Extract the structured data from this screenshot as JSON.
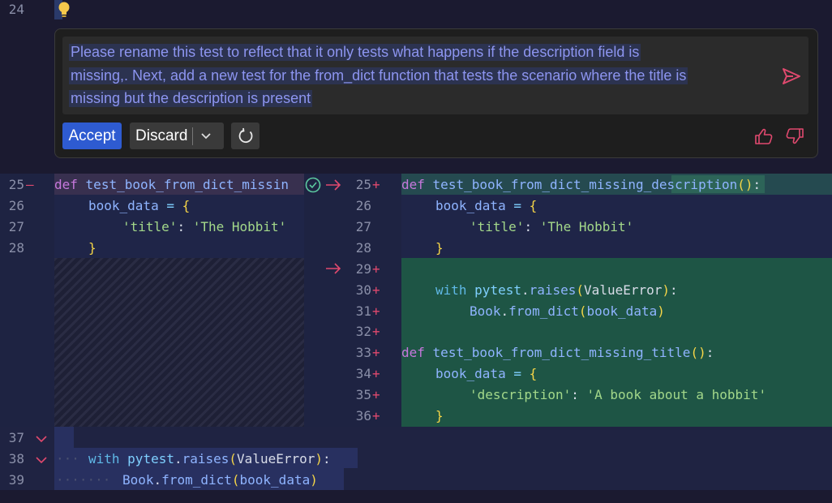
{
  "editor": {
    "line_24": "24",
    "lightbulb": "lightbulb-icon"
  },
  "prompt": {
    "line1": "Please rename this test to reflect that it only tests what happens if the description field is",
    "line2": "missing,. Next, add a new test for the from_dict function that tests the scenario where the title is",
    "line3": "missing but the description is present",
    "send_icon": "send-icon"
  },
  "actions": {
    "accept_label": "Accept",
    "discard_label": "Discard",
    "chevron_icon": "chevron-down-icon",
    "regenerate_icon": "refresh-icon",
    "thumbs_up_icon": "thumbs-up-icon",
    "thumbs_down_icon": "thumbs-down-icon"
  },
  "left": {
    "lines": [
      {
        "num": "25",
        "marker": "—"
      },
      {
        "num": "26",
        "marker": ""
      },
      {
        "num": "27",
        "marker": ""
      },
      {
        "num": "28",
        "marker": ""
      }
    ],
    "code": {
      "def": "def",
      "fn": "test_book_from_dict_missin",
      "var": "book_data",
      "eq": "=",
      "brace_open": "{",
      "key": "'title'",
      "colon": ":",
      "val": "'The Hobbit'",
      "brace_close": "}"
    }
  },
  "right": {
    "lines": [
      {
        "num": "25",
        "marker": "+"
      },
      {
        "num": "26",
        "marker": ""
      },
      {
        "num": "27",
        "marker": ""
      },
      {
        "num": "28",
        "marker": ""
      },
      {
        "num": "29",
        "marker": "+"
      },
      {
        "num": "30",
        "marker": "+"
      },
      {
        "num": "31",
        "marker": "+"
      },
      {
        "num": "32",
        "marker": "+"
      },
      {
        "num": "33",
        "marker": "+"
      },
      {
        "num": "34",
        "marker": "+"
      },
      {
        "num": "35",
        "marker": "+"
      },
      {
        "num": "36",
        "marker": "+"
      }
    ],
    "code": {
      "def": "def",
      "fn1": "test_book_from_dict_missing_description",
      "parens": "()",
      "colon": ":",
      "var": "book_data",
      "eq": "=",
      "brace_open": "{",
      "key_title": "'title'",
      "val_title": "'The Hobbit'",
      "brace_close": "}",
      "with": "with",
      "pytest": "pytest",
      "dot": ".",
      "raises": "raises",
      "paren_open": "(",
      "value_error": "ValueError",
      "paren_close": ")",
      "book": "Book",
      "from_dict": "from_dict",
      "fn2": "test_book_from_dict_missing_title",
      "key_desc": "'description'",
      "val_desc": "'A book about a hobbit'"
    }
  },
  "bottom": {
    "lines": [
      {
        "num": "37"
      },
      {
        "num": "38"
      },
      {
        "num": "39"
      }
    ],
    "code": {
      "with": "with",
      "pytest": "pytest",
      "dot": ".",
      "raises": "raises",
      "paren_open": "(",
      "value_error": "ValueError",
      "paren_close": ")",
      "colon": ":",
      "book": "Book",
      "from_dict": "from_dict",
      "var": "book_data"
    }
  }
}
